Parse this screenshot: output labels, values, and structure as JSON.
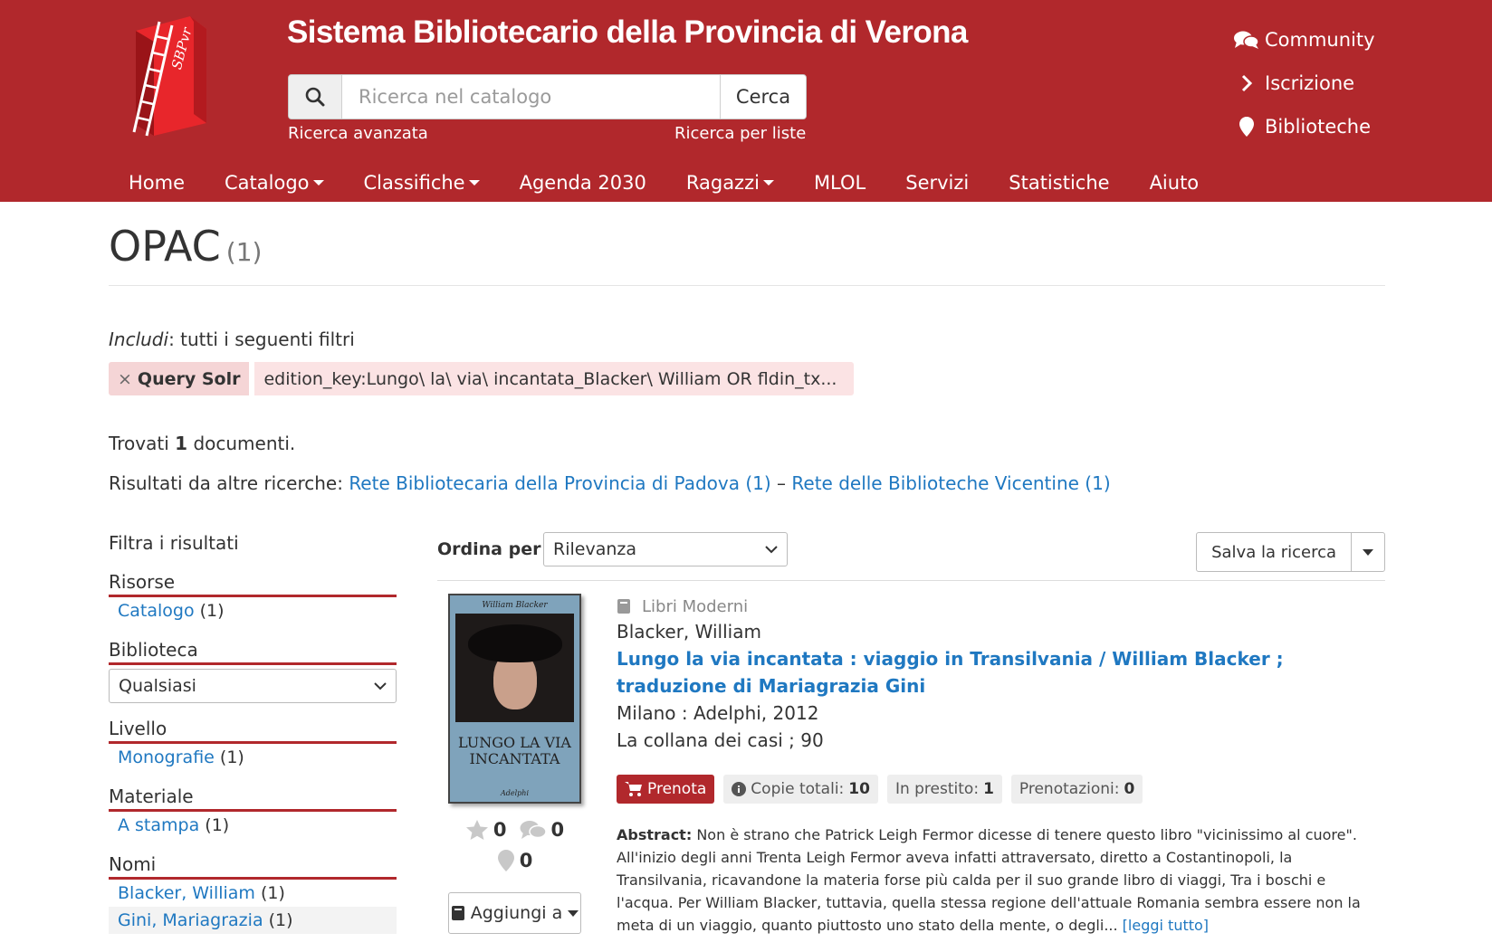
{
  "header": {
    "site_title": "Sistema Bibliotecario della Provincia di Verona",
    "search_placeholder": "Ricerca nel catalogo",
    "search_button": "Cerca",
    "advanced_search": "Ricerca avanzata",
    "list_search": "Ricerca per liste",
    "logo_text": "SBPvr",
    "top_links": [
      {
        "label": "Community",
        "icon": "comments-icon"
      },
      {
        "label": "Iscrizione",
        "icon": "chevron-right-icon"
      },
      {
        "label": "Biblioteche",
        "icon": "map-marker-icon"
      }
    ]
  },
  "nav": [
    {
      "label": "Home",
      "dropdown": false
    },
    {
      "label": "Catalogo",
      "dropdown": true
    },
    {
      "label": "Classifiche",
      "dropdown": true
    },
    {
      "label": "Agenda 2030",
      "dropdown": false
    },
    {
      "label": "Ragazzi",
      "dropdown": true
    },
    {
      "label": "MLOL",
      "dropdown": false
    },
    {
      "label": "Servizi",
      "dropdown": false
    },
    {
      "label": "Statistiche",
      "dropdown": false
    },
    {
      "label": "Aiuto",
      "dropdown": false
    }
  ],
  "page": {
    "title": "OPAC",
    "count": "(1)",
    "filters_label_em": "Includi",
    "filters_label_rest": ": tutti i seguenti filtri",
    "filter_name": "Query Solr",
    "filter_value": "edition_key:Lungo\\ la\\ via\\ incantata_Blacker\\ William OR fldin_tx...",
    "found_prefix": "Trovati",
    "found_count": "1",
    "found_suffix": "documenti.",
    "other_label": "Risultati da altre ricerche:",
    "other_link_1": "Rete Bibliotecaria della Provincia di Padova (1)",
    "other_sep": "–",
    "other_link_2": "Rete delle Biblioteche Vicentine (1)"
  },
  "sidebar": {
    "title": "Filtra i risultati",
    "risorse": {
      "head": "Risorse",
      "item": "Catalogo",
      "count": "(1)"
    },
    "biblioteca": {
      "head": "Biblioteca",
      "select": "Qualsiasi"
    },
    "livello": {
      "head": "Livello",
      "item": "Monografie",
      "count": "(1)"
    },
    "materiale": {
      "head": "Materiale",
      "item": "A stampa",
      "count": "(1)"
    },
    "nomi": {
      "head": "Nomi",
      "items": [
        {
          "label": "Blacker, William",
          "count": "(1)"
        },
        {
          "label": "Gini, Mariagrazia",
          "count": "(1)"
        }
      ]
    }
  },
  "results": {
    "sort_label": "Ordina per",
    "sort_value": "Rilevanza",
    "save_search": "Salva la ricerca",
    "record": {
      "type": "Libri Moderni",
      "author": "Blacker, William",
      "title": "Lungo la via incantata : viaggio in Transilvania / William Blacker ; traduzione di Mariagrazia Gini",
      "publication": "Milano : Adelphi, 2012",
      "series": "La collana dei casi ; 90",
      "cover": {
        "author": "William Blacker",
        "title_line_1": "LUNGO LA VIA",
        "title_line_2": "INCANTATA",
        "publisher": "Adelphi"
      },
      "ratings": "0",
      "comments": "0",
      "places": "0",
      "add_button": "Aggiungi a",
      "prenota": "Prenota",
      "copie_label": "Copie totali:",
      "copie_value": "10",
      "prestito_label": "In prestito:",
      "prestito_value": "1",
      "prenotazioni_label": "Prenotazioni:",
      "prenotazioni_value": "0",
      "abstract_label": "Abstract:",
      "abstract_text": "Non è strano che Patrick Leigh Fermor dicesse di tenere questo libro \"vicinissimo al cuore\". All'inizio degli anni Trenta Leigh Fermor aveva infatti attraversato, diretto a Costantinopoli, la Transilvania, ricavandone la materia forse più calda per il suo grande libro di viaggi, Tra i boschi e l'acqua. Per William Blacker, tuttavia, quella stessa regione dell'attuale Romania sembra essere non la meta di un viaggio, quanto piuttosto uno stato della mente, o degli...",
      "read_more": "[leggi tutto]"
    }
  },
  "colors": {
    "brand_red": "#b1282c",
    "link_blue": "#1f78c1",
    "chip_bg": "#fbe3e4"
  }
}
